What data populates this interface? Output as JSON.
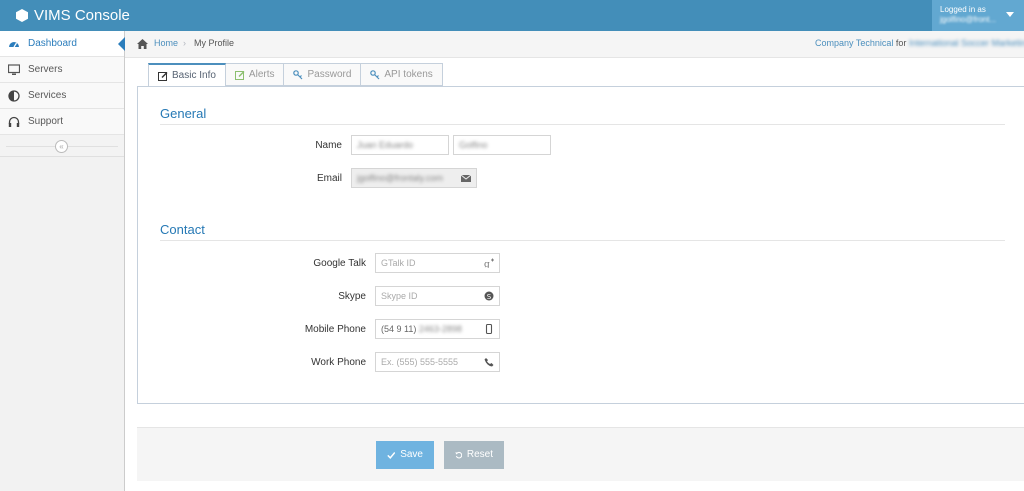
{
  "app": {
    "title": "VIMS Console",
    "brand_icon": "hexagon-icon"
  },
  "user": {
    "logged_in_label": "Logged in as",
    "name": "jgolfino@front..."
  },
  "sidebar": {
    "items": [
      {
        "label": "Dashboard",
        "icon": "dashboard-icon",
        "active": true
      },
      {
        "label": "Servers",
        "icon": "desktop-icon",
        "active": false
      },
      {
        "label": "Services",
        "icon": "adjust-icon",
        "active": false
      },
      {
        "label": "Support",
        "icon": "headphones-icon",
        "active": false
      }
    ],
    "collapse_symbol": "«"
  },
  "breadcrumbs": {
    "home": "Home",
    "separator": "›",
    "current": "My Profile",
    "role": "Company Technical",
    "for_word": "for",
    "organization": "International Soccer Marketing"
  },
  "tabs": [
    {
      "label": "Basic Info",
      "icon": "edit-icon",
      "active": true
    },
    {
      "label": "Alerts",
      "icon": "edit-icon",
      "active": false
    },
    {
      "label": "Password",
      "icon": "key-icon",
      "active": false
    },
    {
      "label": "API tokens",
      "icon": "key-icon",
      "active": false
    }
  ],
  "general": {
    "title": "General",
    "name_label": "Name",
    "first_name": "Juan Eduardo",
    "last_name": "Golfino",
    "email_label": "Email",
    "email": "jgolfino@frontaly.com"
  },
  "contact": {
    "title": "Contact",
    "gtalk_label": "Google Talk",
    "gtalk_placeholder": "GTalk ID",
    "skype_label": "Skype",
    "skype_placeholder": "Skype ID",
    "mobile_label": "Mobile Phone",
    "mobile_prefix": "(54 9 11)",
    "mobile_rest": "2463-2898",
    "work_label": "Work Phone",
    "work_placeholder": "Ex. (555) 555-5555"
  },
  "actions": {
    "save_label": "Save",
    "reset_label": "Reset"
  },
  "colors": {
    "navbar": "#438eb9",
    "accent": "#2679b5",
    "save": "#6fb3e0",
    "reset": "#abbac3"
  }
}
